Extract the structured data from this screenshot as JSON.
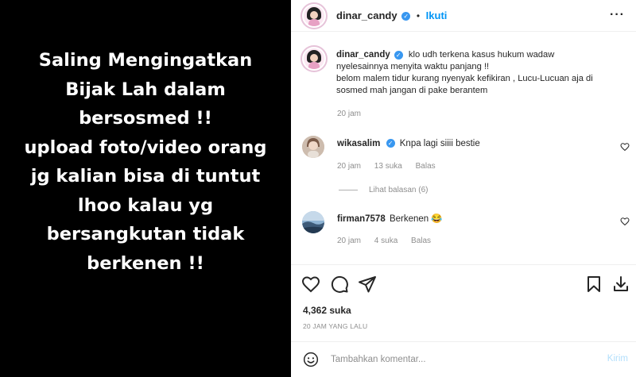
{
  "story": {
    "lines": [
      "Saling Mengingatkan",
      "Bijak Lah dalam",
      "bersosmed !!",
      "upload foto/video orang",
      "jg kalian bisa di tuntut",
      "lhoo kalau yg",
      "bersangkutan tidak",
      "berkenen !!"
    ]
  },
  "header": {
    "username": "dinar_candy",
    "dot": "•",
    "follow_label": "Ikuti",
    "more_label": "···"
  },
  "caption": {
    "username": "dinar_candy",
    "text_line1": "klo udh terkena kasus hukum wadaw",
    "text_line2": "nyelesainnya menyita waktu panjang !!",
    "text_line3": "belom malem tidur kurang nyenyak kefikiran , Lucu-Lucuan aja di",
    "text_line4": "sosmed mah jangan di pake berantem",
    "time": "20 jam"
  },
  "comments": [
    {
      "username": "wikasalim",
      "verified": true,
      "text": "Knpa lagi siiii bestie",
      "time": "20 jam",
      "likes": "13 suka",
      "reply_label": "Balas"
    },
    {
      "username": "firman7578",
      "verified": false,
      "text": "Berkenen 😂",
      "time": "20 jam",
      "likes": "4 suka",
      "reply_label": "Balas"
    }
  ],
  "view_replies": "Lihat balasan (6)",
  "actions": {
    "likes_count": "4,362 suka",
    "posted_ago": "20 JAM YANG LALU"
  },
  "add_comment": {
    "placeholder": "Tambahkan komentar...",
    "post_label": "Kirim"
  },
  "colors": {
    "accent": "#0095f6",
    "verified": "#3897f0",
    "muted": "#8e8e8e",
    "story_bg": "#000000"
  }
}
